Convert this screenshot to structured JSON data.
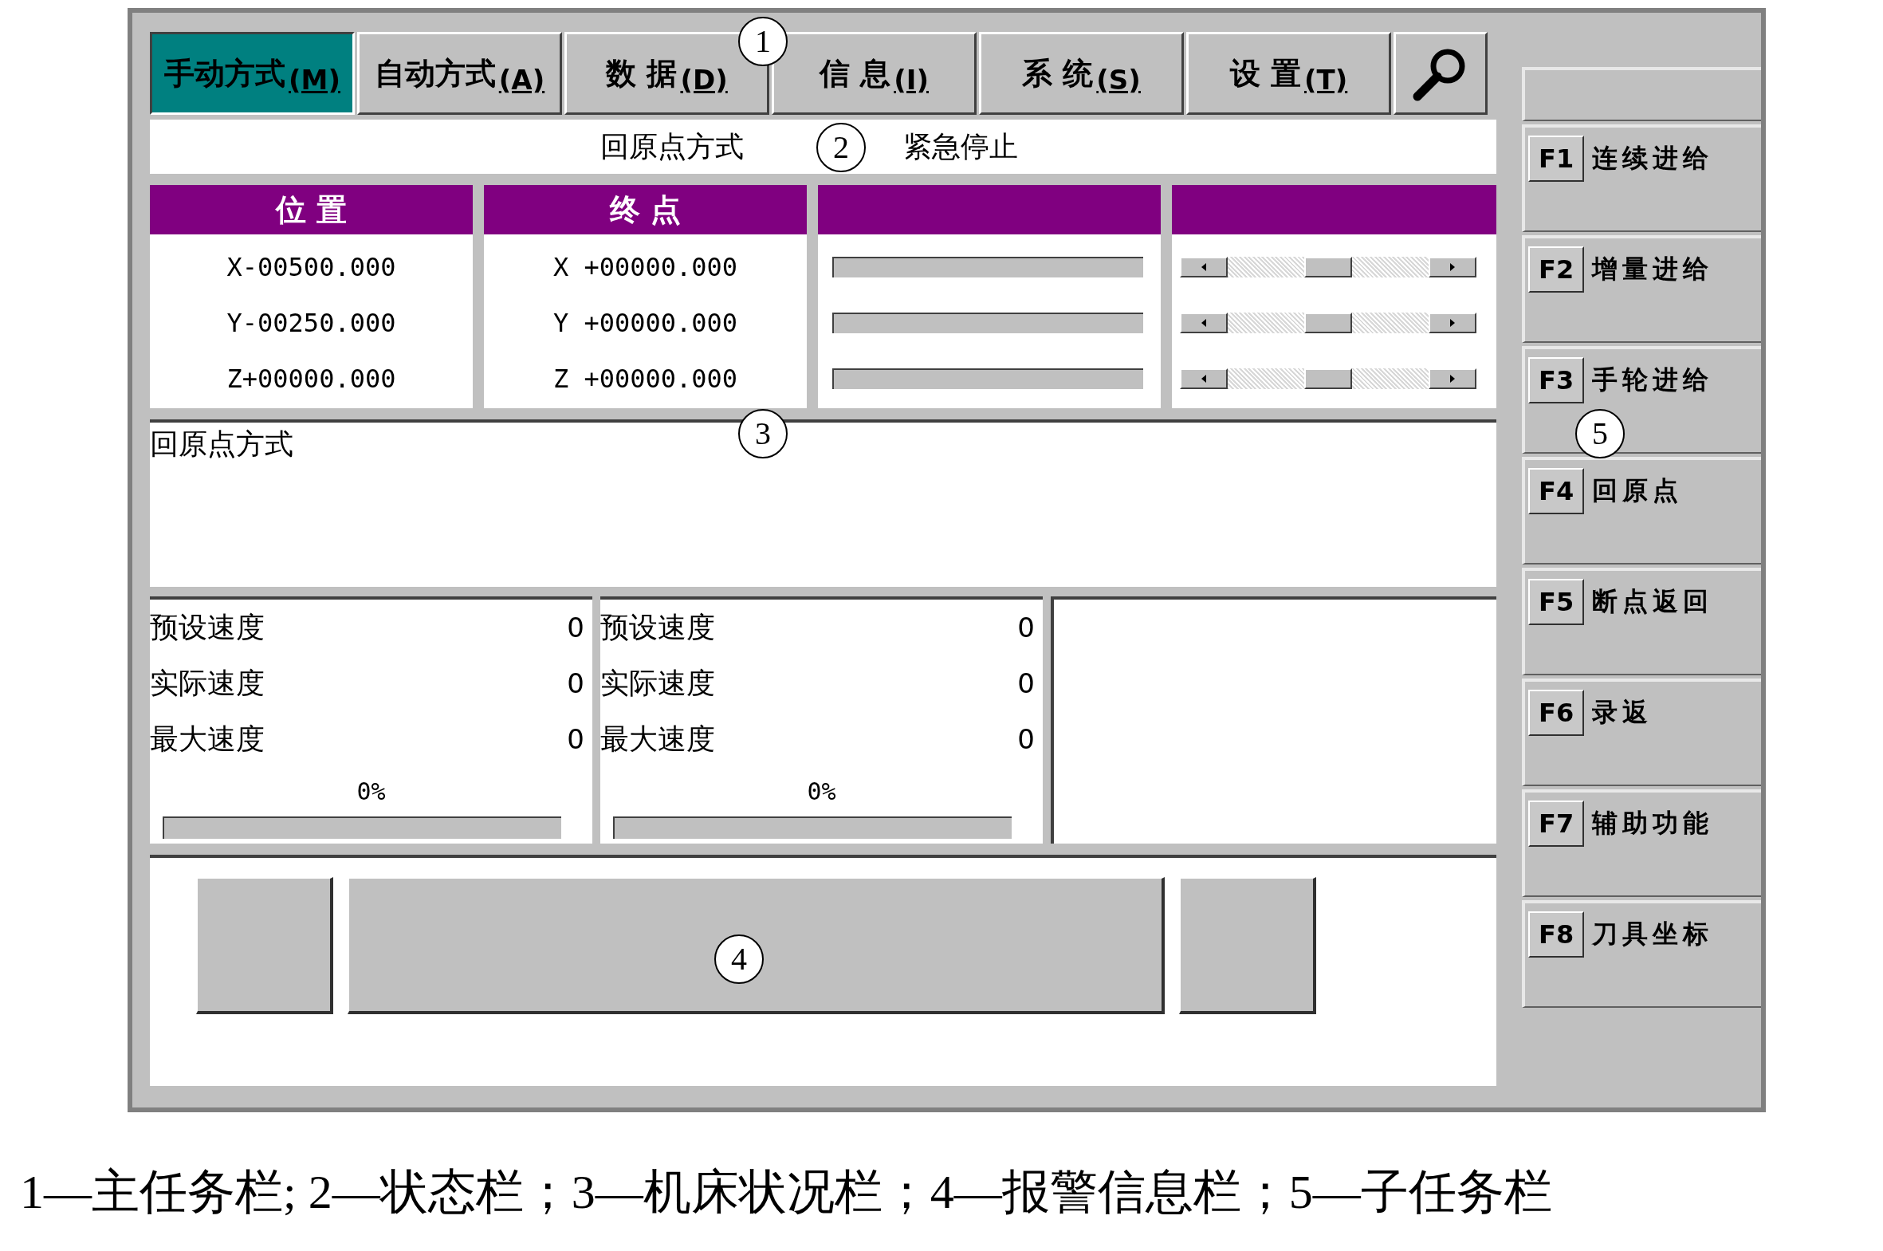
{
  "main_tasks": [
    {
      "label": "手动方式",
      "hotkey": "(M)",
      "selected": true
    },
    {
      "label": "自动方式",
      "hotkey": "(A)",
      "selected": false
    },
    {
      "label": "数 据",
      "hotkey": "(D)",
      "selected": false
    },
    {
      "label": "信 息",
      "hotkey": "(I)",
      "selected": false
    },
    {
      "label": "系 统",
      "hotkey": "(S)",
      "selected": false
    },
    {
      "label": "设 置",
      "hotkey": "(T)",
      "selected": false
    }
  ],
  "status_bar": {
    "mode": "回原点方式",
    "state": "紧急停止"
  },
  "axes_table": {
    "columns": [
      "位 置",
      "终 点"
    ],
    "rows": [
      {
        "position": "X-00500.000",
        "endpoint": "X +00000.000",
        "level": 0.5
      },
      {
        "position": "Y-00250.000",
        "endpoint": "Y +00000.000",
        "level": 0.5
      },
      {
        "position": "Z+00000.000",
        "endpoint": "Z +00000.000",
        "level": 0.5
      }
    ]
  },
  "message": "回原点方式",
  "speed_panels": [
    {
      "rows": [
        {
          "label": "预设速度",
          "value": "0"
        },
        {
          "label": "实际速度",
          "value": "0"
        },
        {
          "label": "最大速度",
          "value": "0"
        }
      ],
      "percent": "0%",
      "level": 0
    },
    {
      "rows": [
        {
          "label": "预设速度",
          "value": "0"
        },
        {
          "label": "实际速度",
          "value": "0"
        },
        {
          "label": "最大速度",
          "value": "0"
        }
      ],
      "percent": "0%",
      "level": 0
    }
  ],
  "subtasks": [
    {
      "key": "F1",
      "label": "连续进给"
    },
    {
      "key": "F2",
      "label": "增量进给"
    },
    {
      "key": "F3",
      "label": "手轮进给"
    },
    {
      "key": "F4",
      "label": "回原点"
    },
    {
      "key": "F5",
      "label": "断点返回"
    },
    {
      "key": "F6",
      "label": "录返"
    },
    {
      "key": "F7",
      "label": "辅助功能"
    },
    {
      "key": "F8",
      "label": "刀具坐标"
    }
  ],
  "callouts": [
    "1",
    "2",
    "3",
    "4",
    "5"
  ],
  "caption": "1—主任务栏; 2—状态栏；3—机床状况栏；4—报警信息栏；5—子任务栏"
}
